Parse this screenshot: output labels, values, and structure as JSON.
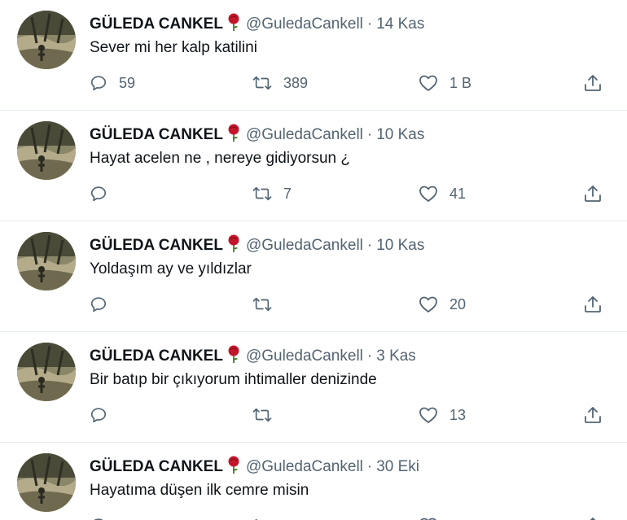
{
  "tweets": [
    {
      "name": "GÜLEDA CANKEL",
      "handle": "@GuledaCankell",
      "date": "14 Kas",
      "text": "Sever mi her kalp katilini",
      "replies": "59",
      "retweets": "389",
      "likes": "1 B"
    },
    {
      "name": "GÜLEDA CANKEL",
      "handle": "@GuledaCankell",
      "date": "10 Kas",
      "text": "Hayat acelen ne , nereye gidiyorsun ¿",
      "replies": "",
      "retweets": "7",
      "likes": "41"
    },
    {
      "name": "GÜLEDA CANKEL",
      "handle": "@GuledaCankell",
      "date": "10 Kas",
      "text": "Yoldaşım ay ve yıldızlar",
      "replies": "",
      "retweets": "",
      "likes": "20"
    },
    {
      "name": "GÜLEDA CANKEL",
      "handle": "@GuledaCankell",
      "date": "3 Kas",
      "text": "Bir batıp bir çıkıyorum ihtimaller denizinde",
      "replies": "",
      "retweets": "",
      "likes": "13"
    },
    {
      "name": "GÜLEDA CANKEL",
      "handle": "@GuledaCankell",
      "date": "30 Eki",
      "text": "Hayatıma düşen ilk cemre misin",
      "replies": "",
      "retweets": "",
      "likes": ""
    }
  ],
  "separator": "·",
  "icons": {
    "reply": "reply-icon",
    "retweet": "retweet-icon",
    "like": "heart-icon",
    "share": "share-icon",
    "rose": "rose-emoji-icon"
  },
  "colors": {
    "text": "#0f1419",
    "secondary": "#536471",
    "rose": "#c4152a",
    "divider": "#e6ecf0"
  }
}
